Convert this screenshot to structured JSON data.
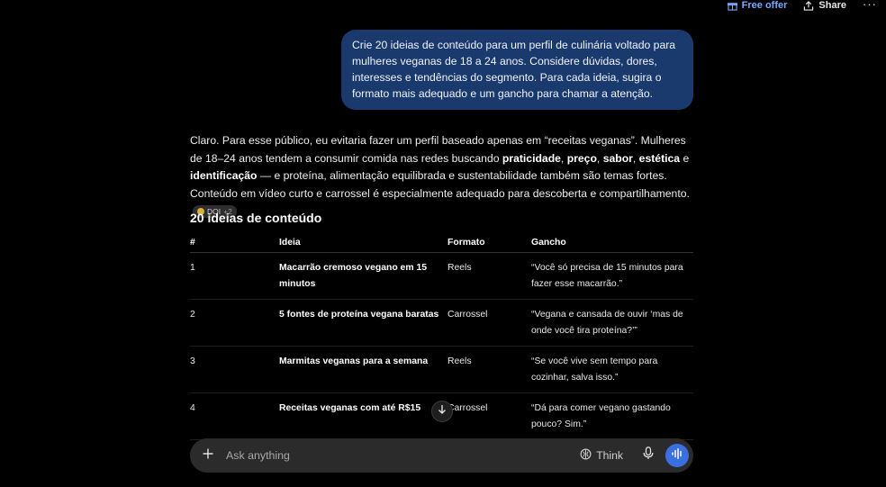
{
  "topbar": {
    "free_offer": "Free offer",
    "share": "Share",
    "more": "···",
    "accent": "#7aa8ff"
  },
  "user_message": "Crie 20 ideias de conteúdo para um perfil de culinária voltado para mulheres veganas de 18 a 24 anos. Considere dúvidas, dores, interesses e tendências do segmento. Para cada ideia, sugira o formato mais adequado e um gancho para chamar a atenção.",
  "answer": {
    "p1": "Claro. Para esse público, eu evitaria fazer um perfil baseado apenas em “receitas veganas”. Mulheres de 18–24 anos tendem a consumir comida nas redes buscando ",
    "b1": "praticidade",
    "sep1": ", ",
    "b2": "preço",
    "sep2": ", ",
    "b3": "sabor",
    "sep3": ", ",
    "b4": "estética",
    "sep4": " e ",
    "b5": "identificação",
    "p2": " — e proteína, alimentação equilibrada e sustentabilidade também são temas fortes. Conteúdo em vídeo curto e carrossel é especialmente adequado para descoberta e compartilhamento.",
    "citation": "DOI",
    "citation_more": "+2"
  },
  "section_title": "20 ideias de conteúdo",
  "table": {
    "headers": [
      "#",
      "Ideia",
      "Formato",
      "Gancho"
    ],
    "rows": [
      {
        "n": "1",
        "idea": "Macarrão cremoso vegano em 15 minutos",
        "format": "Reels",
        "hook": "“Você só precisa de 15 minutos para fazer esse macarrão.”"
      },
      {
        "n": "2",
        "idea": "5 fontes de proteína vegana baratas",
        "format": "Carrossel",
        "hook": "“Vegana e cansada de ouvir ‘mas de onde você tira proteína?’”"
      },
      {
        "n": "3",
        "idea": "Marmitas veganas para a semana",
        "format": "Reels",
        "hook": "“Se você vive sem tempo para cozinhar, salva isso.”"
      },
      {
        "n": "4",
        "idea": "Receitas veganas com até R$15",
        "format": "Carrossel",
        "hook": "“Dá para comer vegano gastando pouco? Sim.”"
      }
    ]
  },
  "composer": {
    "placeholder": "Ask anything",
    "think": "Think",
    "voice_color": "#3b6fe0"
  },
  "colors": {
    "background": "#000000",
    "user_bubble": "#1a3a6e",
    "composer": "#2b2b2b"
  }
}
